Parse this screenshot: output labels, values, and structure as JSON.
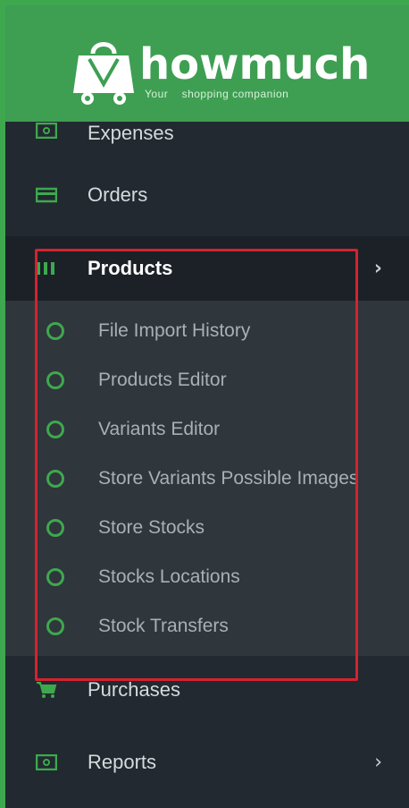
{
  "brand": {
    "name": "howmuch",
    "tagline": "Your    shopping companion",
    "colors": {
      "header": "#3e9f52",
      "accent": "#3ea84e",
      "sidebar": "#222930"
    }
  },
  "menu": {
    "items": [
      {
        "label": "Expenses",
        "icon": "money-icon"
      },
      {
        "label": "Orders",
        "icon": "card-icon"
      },
      {
        "label": "Products",
        "icon": "barcode-icon",
        "active": true,
        "expandable": true
      },
      {
        "label": "Purchases",
        "icon": "cart-icon"
      },
      {
        "label": "Reports",
        "icon": "money-icon",
        "expandable": true
      }
    ],
    "products_submenu": [
      {
        "label": "File Import History"
      },
      {
        "label": "Products Editor"
      },
      {
        "label": "Variants Editor"
      },
      {
        "label": "Store Variants Possible Images"
      },
      {
        "label": "Store Stocks"
      },
      {
        "label": "Stocks Locations"
      },
      {
        "label": "Stock Transfers"
      }
    ],
    "chevron": "›"
  },
  "annotation": {
    "color": "#d3232f"
  }
}
